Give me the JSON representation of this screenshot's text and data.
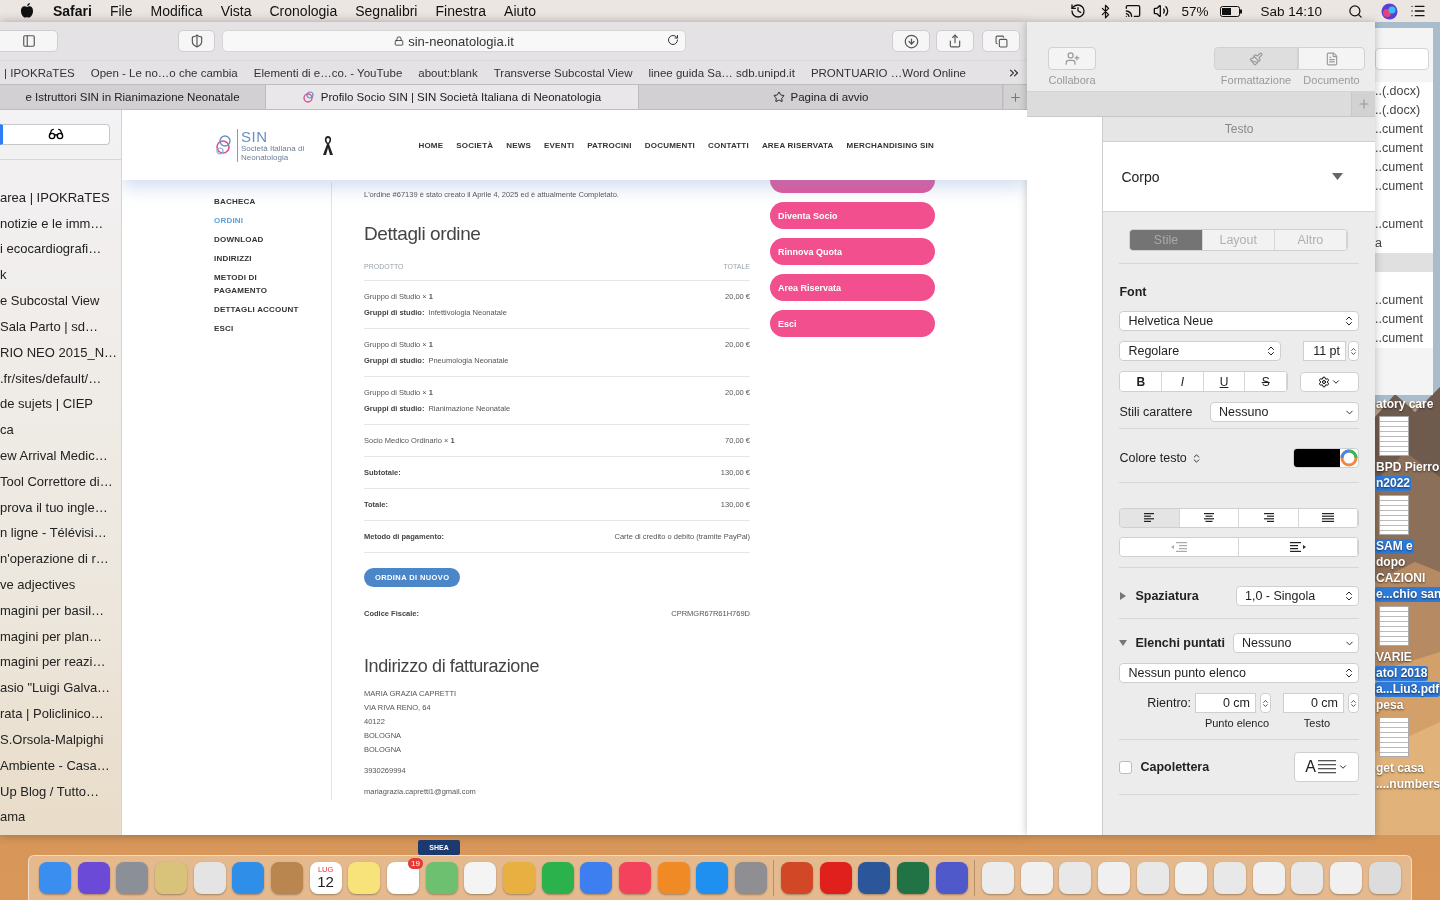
{
  "menubar": {
    "app": "Safari",
    "menus": [
      "File",
      "Modifica",
      "Vista",
      "Cronologia",
      "Segnalibri",
      "Finestra",
      "Aiuto"
    ],
    "battery": "57%",
    "clock": "Sab 14:10"
  },
  "safari": {
    "url": "sin-neonatologia.it",
    "favorites": [
      "| IPOKRaTES",
      "Open - Le no…o che cambia",
      "Elementi di e…co. - YouTube",
      "about:blank",
      "Transverse Subcostal View",
      "linee guida Sa… sdb.unipd.it",
      "PRONTUARIO …Word Online"
    ],
    "tabs": [
      {
        "title": "e Istruttori SIN in Rianimazione Neonatale",
        "selected": false
      },
      {
        "title": "Profilo Socio SIN | SIN Società Italiana di Neonatologia",
        "selected": true
      },
      {
        "title": "Pagina di avvio",
        "selected": false
      }
    ],
    "sidebar": [
      "area | IPOKRaTES",
      "notizie e le imm…",
      "i ecocardiografi…",
      "k",
      "e Subcostal View",
      "Sala Parto | sd…",
      "RIO NEO 2015_N…",
      ".fr/sites/default/…",
      "de sujets | CIEP",
      "ca",
      "ew Arrival Medic…",
      "Tool Correttore di…",
      "prova il tuo ingle…",
      "n ligne - Télévisi…",
      "n'operazione di r…",
      "ve adjectives",
      "magini per basil…",
      "magini per plan…",
      "magini per reazi…",
      "asio \"Luigi Galva…",
      "rata | Policlinico…",
      "S.Orsola-Malpighi",
      "Ambiente - Casa…",
      "Up Blog / Tutto…",
      "ama"
    ],
    "page": {
      "logo": {
        "name": "SIN",
        "tagline": "Società Italiana di Neonatologia"
      },
      "nav": [
        "HOME",
        "SOCIETÀ",
        "NEWS",
        "EVENTI",
        "PATROCINI",
        "DOCUMENTI",
        "CONTATTI",
        "AREA RISERVATA",
        "MERCHANDISING SIN"
      ],
      "account_menu": [
        {
          "label": "BACHECA",
          "selected": false
        },
        {
          "label": "ORDINI",
          "selected": true
        },
        {
          "label": "DOWNLOAD",
          "selected": false
        },
        {
          "label": "INDIRIZZI",
          "selected": false
        },
        {
          "label": "METODI DI PAGAMENTO",
          "selected": false
        },
        {
          "label": "DETTAGLI ACCOUNT",
          "selected": false
        },
        {
          "label": "ESCI",
          "selected": false
        }
      ],
      "notice": "L'ordine #67139 è stato creato il Aprile 4, 2025 ed è attualmente Completato.",
      "order": {
        "title": "Dettagli ordine",
        "columns": [
          "PRODOTTO",
          "TOTALE"
        ],
        "items": [
          {
            "product": "Gruppo di Studio × **1**",
            "meta_label": "Gruppi di studio:",
            "meta_value": "Infettivologia Neonatale",
            "total": "20,00 €"
          },
          {
            "product": "Gruppo di Studio × **1**",
            "meta_label": "Gruppi di studio:",
            "meta_value": "Pneumologia Neonatale",
            "total": "20,00 €"
          },
          {
            "product": "Gruppo di Studio × **1**",
            "meta_label": "Gruppi di studio:",
            "meta_value": "Rianimazione Neonatale",
            "total": "20,00 €"
          },
          {
            "product": "Socio Medico Ordinario × **1**",
            "total": "70,00 €"
          }
        ],
        "totals": [
          {
            "label": "Subtotale:",
            "value": "130,00 €"
          },
          {
            "label": "Totale:",
            "value": "130,00 €"
          },
          {
            "label": "Metodo di pagamento:",
            "value": "Carte di credito o debito (tramite PayPal)"
          }
        ],
        "action": "ORDINA DI NUOVO",
        "tax_code": {
          "label": "Codice Fiscale:",
          "value": "CPRMGR67R61H769D"
        }
      },
      "billing": {
        "title": "Indirizzo di fatturazione",
        "address": [
          "MARIA GRAZIA CAPRETTI",
          "VIA RIVA RENO, 64",
          "40122",
          "BOLOGNA",
          "BOLOGNA"
        ],
        "phone": "3930269994",
        "email": "mariagrazia.capretti1@gmail.com"
      },
      "side_buttons": [
        "Diventa Socio",
        "Rinnova Quota",
        "Area Riservata",
        "Esci"
      ]
    }
  },
  "pages": {
    "toolbar": {
      "collaborate": "Collabora",
      "segments": [
        {
          "label": "Formattazione",
          "kind": "format",
          "selected": true
        },
        {
          "label": "Documento",
          "kind": "document",
          "selected": false
        }
      ]
    },
    "inspector": {
      "title": "Testo",
      "paragraph_style": "Corpo",
      "tabs": [
        {
          "label": "Stile",
          "selected": true
        },
        {
          "label": "Layout",
          "selected": false
        },
        {
          "label": "Altro",
          "selected": false
        }
      ],
      "font_heading": "Font",
      "font_family": "Helvetica Neue",
      "typeface": "Regolare",
      "size": "11 pt",
      "format_buttons": [
        {
          "label": "B",
          "kind": "bold"
        },
        {
          "label": "I",
          "kind": "italic"
        },
        {
          "label": "U",
          "kind": "underline"
        },
        {
          "label": "S",
          "kind": "strike"
        }
      ],
      "char_styles": {
        "label": "Stili carattere",
        "value": "Nessuno"
      },
      "text_color": {
        "label": "Colore testo",
        "color": "#000000"
      },
      "alignment": [
        {
          "kind": "left",
          "selected": true
        },
        {
          "kind": "center",
          "selected": false
        },
        {
          "kind": "right",
          "selected": false
        },
        {
          "kind": "justify",
          "selected": false
        }
      ],
      "spacing": {
        "label": "Spaziatura",
        "expanded": false,
        "value": "1,0 - Singola"
      },
      "bullets": {
        "label": "Elenchi puntati",
        "expanded": true,
        "value": "Nessuno",
        "bullet_type": "Nessun punto elenco",
        "indent_label": "Rientro:",
        "indents": [
          {
            "value": "0 cm",
            "caption": "Punto elenco"
          },
          {
            "value": "0 cm",
            "caption": "Testo"
          }
        ]
      },
      "drop_cap": {
        "label": "Capolettera",
        "checked": false,
        "preview": "A"
      }
    }
  },
  "desktop": {
    "finder_rows": [
      {
        "kind": "file",
        "name": "..(.docx)"
      },
      {
        "kind": "file",
        "name": "..(.docx)"
      },
      {
        "kind": "file",
        "name": "..cument"
      },
      {
        "kind": "file",
        "name": "..cument"
      },
      {
        "kind": "file",
        "name": "..cument"
      },
      {
        "kind": "file",
        "name": "..cument"
      },
      {
        "kind": "blank"
      },
      {
        "kind": "file",
        "name": "..cument"
      },
      {
        "kind": "file",
        "name": "a"
      },
      {
        "kind": "group"
      },
      {
        "kind": "blank"
      },
      {
        "kind": "file",
        "name": "..cument"
      },
      {
        "kind": "file",
        "name": "..cument"
      },
      {
        "kind": "file",
        "name": "..cument"
      }
    ],
    "items": [
      {
        "kind": "label",
        "text": "atory care",
        "selected": false
      },
      {
        "kind": "doc"
      },
      {
        "kind": "label",
        "text": "BPD Pierro",
        "selected": false
      },
      {
        "kind": "label",
        "text": "n2022",
        "selected": true
      },
      {
        "kind": "doc"
      },
      {
        "kind": "label",
        "text": "SAM e",
        "selected": true
      },
      {
        "kind": "label",
        "text": "dopo",
        "selected": false
      },
      {
        "kind": "label",
        "text": "CAZIONI",
        "selected": false
      },
      {
        "kind": "label",
        "text": "e...chio san",
        "selected": true
      },
      {
        "kind": "doc"
      },
      {
        "kind": "label",
        "text": "VARIE",
        "selected": false
      },
      {
        "kind": "label",
        "text": "atol 2018",
        "selected": true
      },
      {
        "kind": "label",
        "text": "a...Liu3.pdf",
        "selected": true
      },
      {
        "kind": "label",
        "text": "pesa",
        "selected": false
      },
      {
        "kind": "doc"
      },
      {
        "kind": "label",
        "text": "get casa",
        "selected": false
      },
      {
        "kind": "label",
        "text": "....numbers",
        "selected": false
      }
    ]
  },
  "dock": {
    "thumbnail_text": "SHEA",
    "calendar_month": "LUG",
    "calendar_day": "12",
    "badge": "19"
  }
}
